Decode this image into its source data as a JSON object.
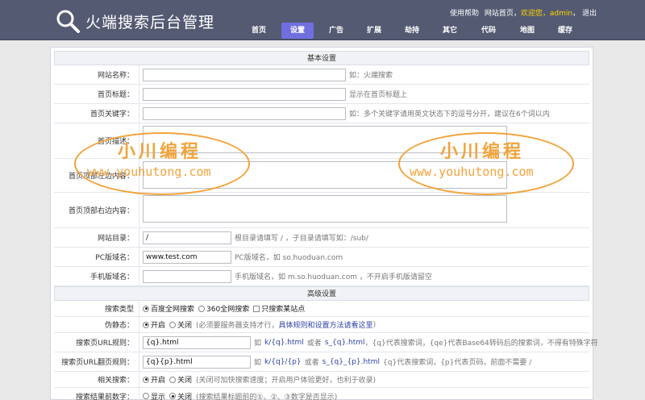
{
  "header": {
    "title": "火端搜索后台管理",
    "toplinks": {
      "help": "使用帮助",
      "home": "网站首页",
      "welcome": "欢迎您，admin",
      "logout": "退出"
    },
    "nav": [
      "首页",
      "设置",
      "广告",
      "扩展",
      "劫持",
      "其它",
      "代码",
      "地图",
      "缓存"
    ],
    "active_nav": "设置"
  },
  "sections": {
    "basic": "基本设置",
    "advanced": "高级设置"
  },
  "basic": {
    "site_name": {
      "label": "网站名称：",
      "value": "",
      "hint": "如：火端搜索"
    },
    "home_title": {
      "label": "首页标题：",
      "value": "",
      "hint": "显示在首页标题上"
    },
    "home_keywords": {
      "label": "首页关键字：",
      "value": "",
      "hint": "如：多个关键字请用英文状态下的逗号分开，建议在6个词以内"
    },
    "home_desc": {
      "label": "首页描述："
    },
    "top_left": {
      "label": "首页顶部左边内容："
    },
    "top_right": {
      "label": "首页顶部右边内容："
    },
    "site_dir": {
      "label": "网站目录：",
      "value": "/",
      "hint": "根目录请填写 / ，子目录请填写如：/sub/"
    },
    "pc_domain": {
      "label": "PC版域名：",
      "value": "www.test.com",
      "hint": "PC版域名，如 so.huoduan.com"
    },
    "mobile_domain": {
      "label": "手机版域名：",
      "value": "",
      "hint": "手机版域名，如 m.so.huoduan.com ，不开启手机版请留空"
    }
  },
  "advanced": {
    "search_type": {
      "label": "搜索类型",
      "opt1": "百度全网搜索",
      "opt2": "360全网搜索",
      "opt3": "只搜索某站点"
    },
    "pseudo_static": {
      "label": "伪静态：",
      "on": "开启",
      "off": "关闭",
      "hint_pre": "(必须要服务器支持才行，",
      "hint_link": "具体规则和设置方法请看这里",
      "hint_post": ")"
    },
    "search_url": {
      "label": "搜索页URL规则：",
      "value": "{q}.html",
      "ex_pre": "如",
      "ex1": "k/{q}.html",
      "ex_or": "或者",
      "ex2": "s_{q}.html",
      "hint": "，{q}代表搜索词，{qe}代表Base64转码后的搜索词，不得有特殊字符"
    },
    "page_url": {
      "label": "搜索页URL翻页规则：",
      "value": "{q}{p}.html",
      "ex_pre": "如",
      "ex1": "k/{q}/{p}",
      "ex_or": "或者",
      "ex2": "s_{q}_{p}.html",
      "hint": "{q}代表搜索词，{p}代表页码，前面不需要 /"
    },
    "related": {
      "label": "相关搜索：",
      "on": "开启",
      "off": "关闭",
      "hint": "(关闭可加快搜索速度；开启用户体验更好，也利于收录)"
    },
    "result_num": {
      "label": "搜索结果前数字：",
      "on": "显示",
      "off": "关闭",
      "hint": "(搜索结果标题前的①、②、③数字是否显示)"
    }
  },
  "watermark": {
    "cn": "小川编程",
    "url": "www.youhutong.com"
  },
  "colors": {
    "header_bg": "#545a72",
    "nav_active": "#6f6fe0",
    "watermark": "#f2a33b",
    "link": "#2f43a8",
    "welcome": "#ffd800"
  }
}
